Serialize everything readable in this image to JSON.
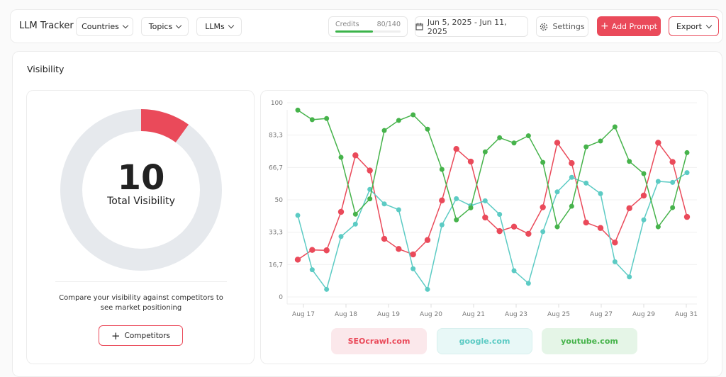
{
  "header": {
    "title": "LLM Tracker",
    "filters": [
      "Countries",
      "Topics",
      "LLMs"
    ],
    "credits_label": "Credits",
    "credits_value": "80/140",
    "credits_fraction": 0.571,
    "date_range": "Jun 5, 2025 - Jun 11, 2025",
    "settings": "Settings",
    "add_prompt": "Add Prompt",
    "export": "Export"
  },
  "section_title": "Visibility",
  "donut": {
    "value": "10",
    "label": "Total Visibility",
    "percent": 10,
    "color": "#ea4a5a",
    "track": "#e6e9ed",
    "description": "Compare your visibility against competitors to see market positioning",
    "competitors_button": "Competitors"
  },
  "chart_data": {
    "type": "line",
    "ylim": [
      0,
      100
    ],
    "yticks": [
      "0",
      "16,7",
      "33,3",
      "50",
      "66,7",
      "83,3",
      "100"
    ],
    "xticks": [
      "Aug 17",
      "Aug 18",
      "Aug 19",
      "Aug 20",
      "Aug 21",
      "Aug 23",
      "Aug 25",
      "Aug 27",
      "Aug 29",
      "Aug 31"
    ],
    "grid": true,
    "series": [
      {
        "name": "SEOcrawl.com",
        "color": "#ea4a5a",
        "bg": "#fbe8eb",
        "values": [
          19.2,
          24.2,
          24,
          43.8,
          72.9,
          65.1,
          29.9,
          24.7,
          21.9,
          29.3,
          49.7,
          76.2,
          69.7,
          40.9,
          33.9,
          36.2,
          32.5,
          46.2,
          79.4,
          68.9,
          38.3,
          35.5,
          28,
          45.7,
          52.2,
          79.4,
          69.5,
          41.2
        ]
      },
      {
        "name": "google.com",
        "color": "#5ccbc4",
        "bg": "#e8f8f7",
        "values": [
          42,
          14,
          3.9,
          31.1,
          37.5,
          55.4,
          47.9,
          44.9,
          14.5,
          3.9,
          37.1,
          50.6,
          47,
          49.5,
          42.5,
          13.5,
          7,
          33.6,
          54.1,
          61.6,
          58.6,
          53.2,
          18.1,
          10.3,
          39.7,
          59.5,
          59,
          64
        ]
      },
      {
        "name": "youtube.com",
        "color": "#46b34b",
        "bg": "#e5f5e7",
        "values": [
          96.2,
          91.3,
          91.9,
          71.9,
          42.6,
          50.5,
          85.7,
          90.9,
          93.8,
          86.4,
          65.7,
          39.7,
          45.9,
          74.7,
          82,
          79.3,
          83,
          69.3,
          36.1,
          46.7,
          77.3,
          80.3,
          87.6,
          69.8,
          63.5,
          36.1,
          46,
          74.3
        ]
      }
    ]
  }
}
